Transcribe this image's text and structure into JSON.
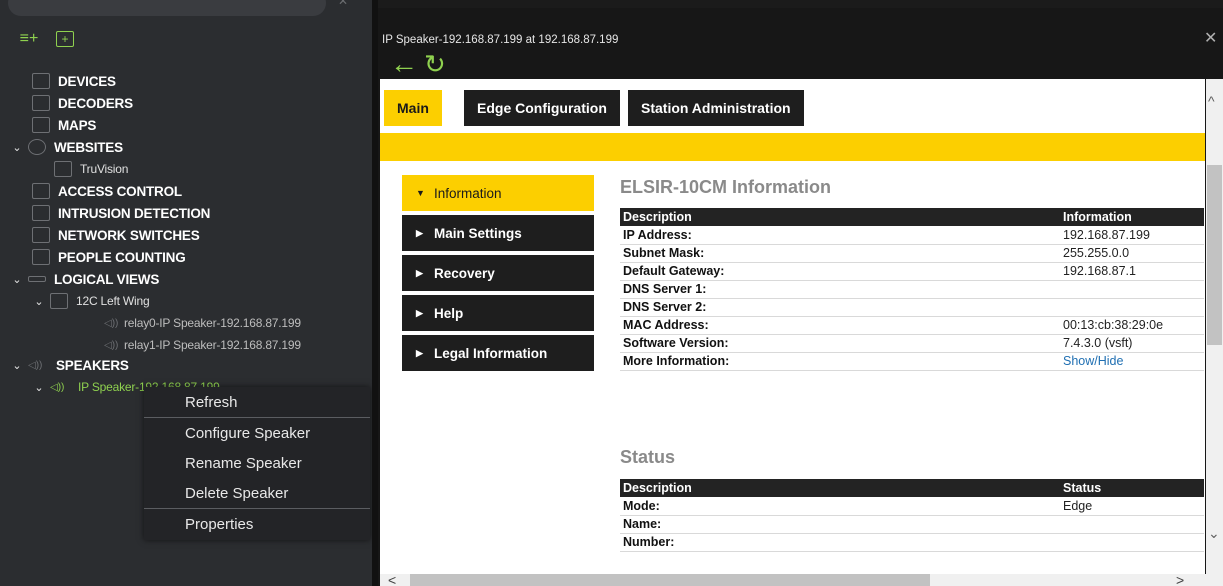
{
  "tree": {
    "items": [
      {
        "label": "DEVICES"
      },
      {
        "label": "DECODERS"
      },
      {
        "label": "MAPS"
      },
      {
        "label": "WEBSITES"
      },
      {
        "label": "TruVision"
      },
      {
        "label": "ACCESS CONTROL"
      },
      {
        "label": "INTRUSION DETECTION"
      },
      {
        "label": "NETWORK SWITCHES"
      },
      {
        "label": "PEOPLE COUNTING"
      },
      {
        "label": "LOGICAL VIEWS"
      },
      {
        "label": "12C Left Wing"
      },
      {
        "label": "relay0-IP Speaker-192.168.87.199"
      },
      {
        "label": "relay1-IP Speaker-192.168.87.199"
      },
      {
        "label": "SPEAKERS"
      },
      {
        "label": "IP Speaker-192.168.87.199"
      }
    ]
  },
  "context_menu": {
    "items": [
      "Refresh",
      "Configure Speaker",
      "Rename Speaker",
      "Delete Speaker",
      "Properties"
    ]
  },
  "window": {
    "title": "IP Speaker-192.168.87.199 at 192.168.87.199",
    "close": "✕",
    "back": "←",
    "refresh": "↻"
  },
  "web": {
    "tabs": [
      "Main",
      "Edge Configuration",
      "Station Administration"
    ],
    "side_menu": [
      "Information",
      "Main Settings",
      "Recovery",
      "Help",
      "Legal Information"
    ],
    "info_heading": "ELSIR-10CM Information",
    "info_table": {
      "headers": [
        "Description",
        "Information"
      ],
      "rows": [
        [
          "IP Address:",
          "192.168.87.199"
        ],
        [
          "Subnet Mask:",
          "255.255.0.0"
        ],
        [
          "Default Gateway:",
          "192.168.87.1"
        ],
        [
          "DNS Server 1:",
          ""
        ],
        [
          "DNS Server 2:",
          ""
        ],
        [
          "MAC Address:",
          "00:13:cb:38:29:0e"
        ],
        [
          "Software Version:",
          "7.4.3.0 (vsft)"
        ],
        [
          "More Information:",
          "Show/Hide"
        ]
      ]
    },
    "status_heading": "Status",
    "status_table": {
      "headers": [
        "Description",
        "Status"
      ],
      "rows": [
        [
          "Mode:",
          "Edge"
        ],
        [
          "Name:",
          ""
        ],
        [
          "Number:",
          ""
        ]
      ]
    }
  }
}
